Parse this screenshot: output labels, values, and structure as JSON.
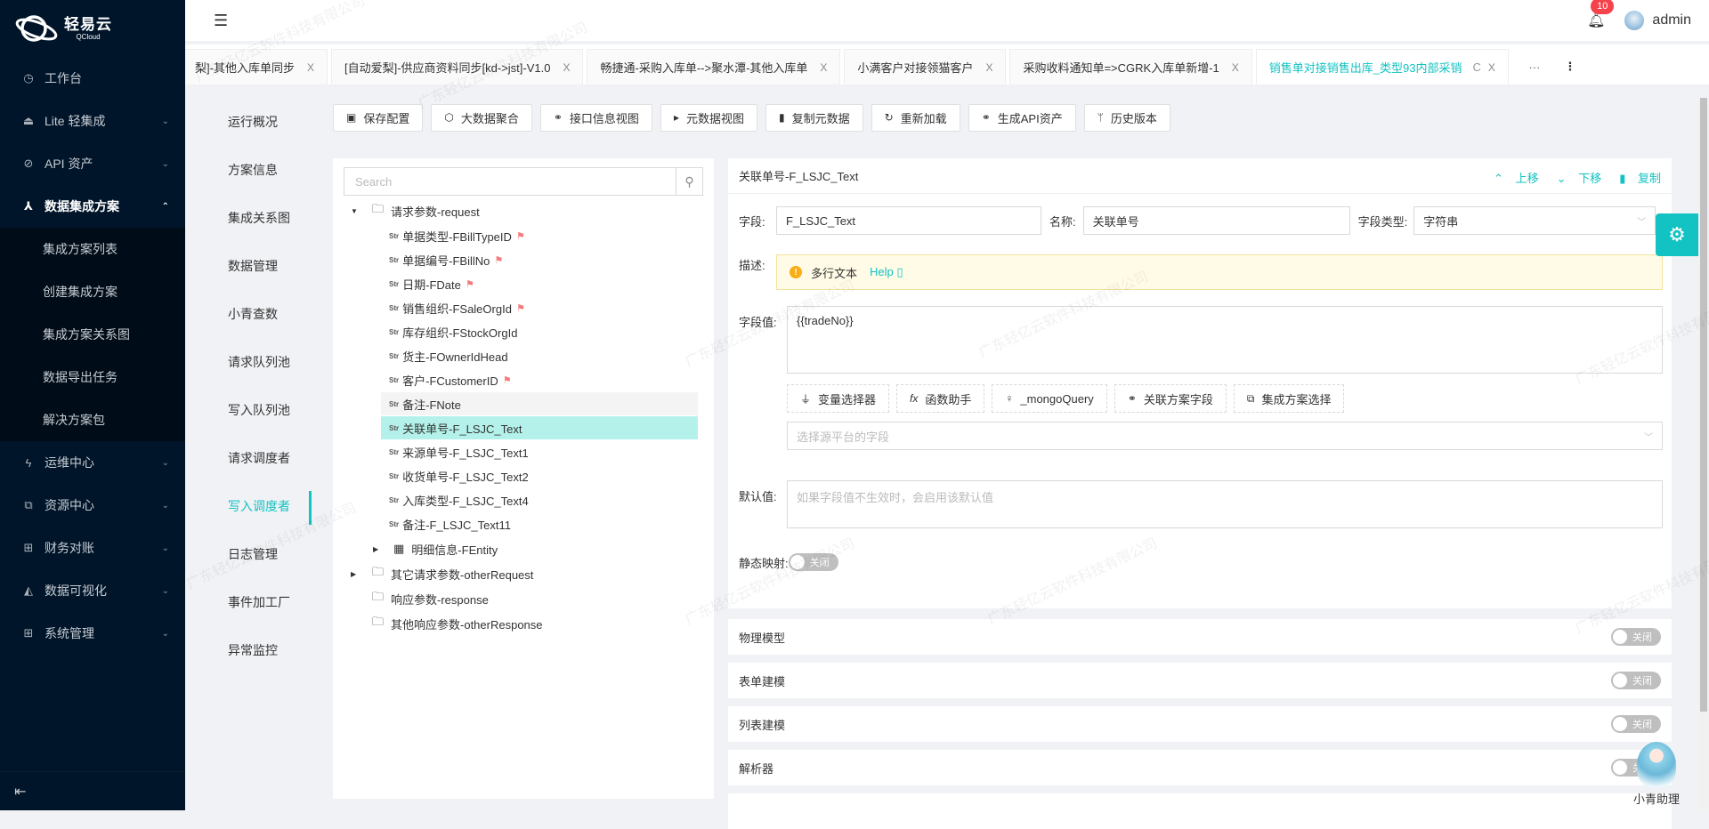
{
  "brand": {
    "name": "轻易云",
    "sub": "QCloud"
  },
  "sidebar": {
    "items": [
      {
        "label": "工作台",
        "icon": "clock-icon",
        "glyph": "◷"
      },
      {
        "label": "Lite 轻集成",
        "icon": "alarm-icon",
        "glyph": "⏏",
        "chevron": "⌄"
      },
      {
        "label": "API 资产",
        "icon": "compass-icon",
        "glyph": "⊘",
        "chevron": "⌄"
      },
      {
        "label": "数据集成方案",
        "icon": "nodes-icon",
        "glyph": "⅄",
        "chevron": "⌃"
      }
    ],
    "submenu": [
      "集成方案列表",
      "创建集成方案",
      "集成方案关系图",
      "数据导出任务",
      "解决方案包"
    ],
    "items_after": [
      {
        "label": "运维中心",
        "icon": "lightning-icon",
        "glyph": "ϟ",
        "chevron": "⌄"
      },
      {
        "label": "资源中心",
        "icon": "cluster-icon",
        "glyph": "⧉",
        "chevron": "⌄"
      },
      {
        "label": "财务对账",
        "icon": "calculator-icon",
        "glyph": "⊞",
        "chevron": "⌄"
      },
      {
        "label": "数据可视化",
        "icon": "area-chart-icon",
        "glyph": "◭",
        "chevron": "⌄"
      },
      {
        "label": "系统管理",
        "icon": "appstore-icon",
        "glyph": "⊞",
        "chevron": "⌄"
      }
    ],
    "collapse_glyph": "⇤"
  },
  "header": {
    "fold_glyph": "☰",
    "notifications": "10",
    "user": "admin"
  },
  "tabs": [
    {
      "label": "[自动爱梨]-其他入库单同步",
      "display": "梨]-其他入库单同步"
    },
    {
      "label": "[自动爱梨]-供应商资料同步[kd->jst]-V1.0"
    },
    {
      "label": "畅捷通-采购入库单-->聚水潭-其他入库单"
    },
    {
      "label": "小满客户对接领猫客户"
    },
    {
      "label": "采购收料通知单=>CGRK入库单新增-1"
    },
    {
      "label": "销售单对接销售出库_类型93内部采销",
      "active": true
    }
  ],
  "tab_close": "X",
  "tab_refresh": "C",
  "tab_more": "···",
  "tab_menu": "⋮",
  "subnav": [
    "运行概况",
    "方案信息",
    "集成关系图",
    "数据管理",
    "小青查数",
    "请求队列池",
    "写入队列池",
    "请求调度者",
    "写入调度者",
    "日志管理",
    "事件加工厂",
    "异常监控"
  ],
  "subnav_active": "写入调度者",
  "toolbar": [
    {
      "label": "保存配置",
      "icon": "save-icon",
      "glyph": "▣"
    },
    {
      "label": "大数据聚合",
      "icon": "aggregate-icon",
      "glyph": "⬡"
    },
    {
      "label": "接口信息视图",
      "icon": "link-icon",
      "glyph": "⚭"
    },
    {
      "label": "元数据视图",
      "icon": "terminal-icon",
      "glyph": "▸"
    },
    {
      "label": "复制元数据",
      "icon": "copy-icon",
      "glyph": "▮"
    },
    {
      "label": "重新加载",
      "icon": "reload-icon",
      "glyph": "↻"
    },
    {
      "label": "生成API资产",
      "icon": "link-icon",
      "glyph": "⚭"
    },
    {
      "label": "历史版本",
      "icon": "branch-icon",
      "glyph": "ᛘ"
    }
  ],
  "tree": {
    "search_placeholder": "Search",
    "root": "请求参数-request",
    "children": [
      {
        "label": "单据类型-FBillTypeID",
        "flag": true
      },
      {
        "label": "单据编号-FBillNo",
        "flag": true
      },
      {
        "label": "日期-FDate",
        "flag": true
      },
      {
        "label": "销售组织-FSaleOrgId",
        "flag": true
      },
      {
        "label": "库存组织-FStockOrgId",
        "flag": false
      },
      {
        "label": "货主-FOwnerIdHead",
        "flag": false
      },
      {
        "label": "客户-FCustomerID",
        "flag": true
      },
      {
        "label": "备注-FNote",
        "flag": false,
        "hover": true
      },
      {
        "label": "关联单号-F_LSJC_Text",
        "flag": false,
        "selected": true
      },
      {
        "label": "来源单号-F_LSJC_Text1",
        "flag": false
      },
      {
        "label": "收货单号-F_LSJC_Text2",
        "flag": false
      },
      {
        "label": "入库类型-F_LSJC_Text4",
        "flag": false
      },
      {
        "label": "备注-F_LSJC_Text11",
        "flag": false
      }
    ],
    "entity": "明细信息-FEntity",
    "others": [
      "其它请求参数-otherRequest",
      "响应参数-response",
      "其他响应参数-otherResponse"
    ],
    "str_tag": "Str"
  },
  "detail": {
    "title": "关联单号-F_LSJC_Text",
    "actions": [
      {
        "label": "上移",
        "glyph": "⌃"
      },
      {
        "label": "下移",
        "glyph": "⌄"
      },
      {
        "label": "复制",
        "glyph": "▮"
      }
    ],
    "field_label": "字段:",
    "field_value": "F_LSJC_Text",
    "name_label": "名称:",
    "name_value": "关联单号",
    "type_label": "字段类型:",
    "type_value": "字符串",
    "desc_label": "描述:",
    "desc_text": "多行文本",
    "help": "Help",
    "value_label": "字段值:",
    "value_text": "{{tradeNo}}",
    "helpers": [
      {
        "label": "变量选择器",
        "glyph": "⏚"
      },
      {
        "label": "函数助手",
        "glyph": "fx"
      },
      {
        "label": "_mongoQuery",
        "glyph": "♀"
      },
      {
        "label": "关联方案字段",
        "glyph": "⚭"
      },
      {
        "label": "集成方案选择",
        "glyph": "⧉"
      }
    ],
    "source_placeholder": "选择源平台的字段",
    "default_label": "默认值:",
    "default_placeholder": "如果字段值不生效时，会启用该默认值",
    "static_label": "静态映射:",
    "static_state": "关闭"
  },
  "sections": [
    {
      "label": "物理模型",
      "state": "关闭"
    },
    {
      "label": "表单建模",
      "state": "关闭"
    },
    {
      "label": "列表建模",
      "state": "关闭"
    },
    {
      "label": "解析器",
      "state": "关闭"
    }
  ],
  "assistant": "小青助理",
  "watermark": "广东轻亿云软件科技有限公司"
}
